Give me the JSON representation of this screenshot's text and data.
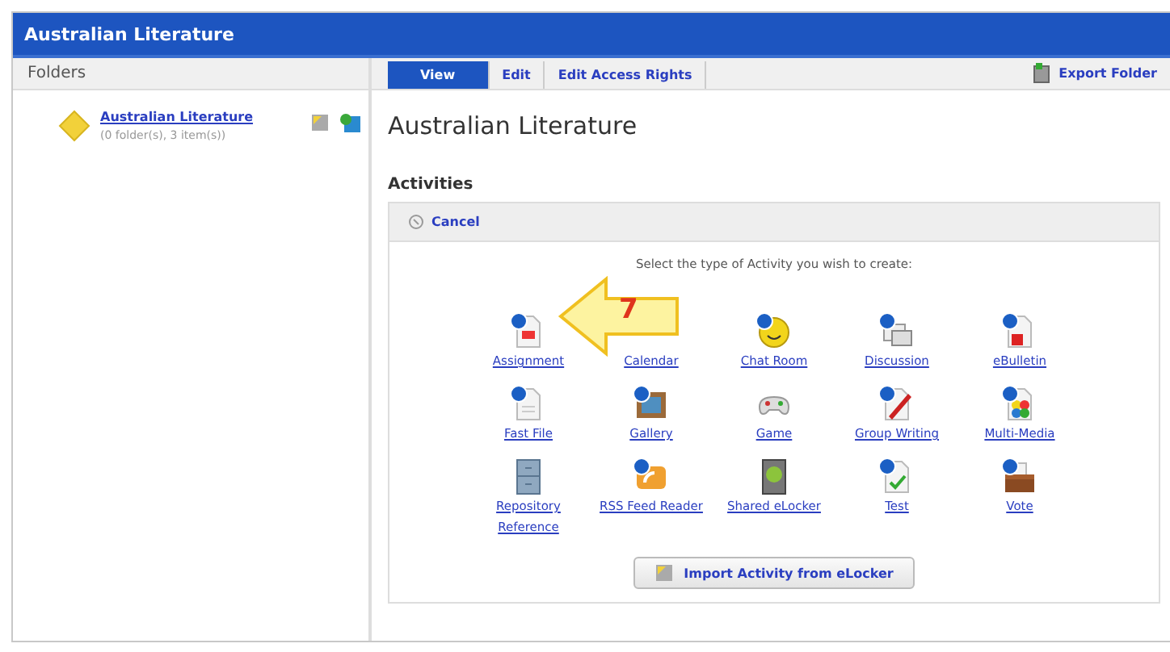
{
  "window": {
    "title": "Australian Literature"
  },
  "sidebar": {
    "header": "Folders",
    "folders": [
      {
        "name": "Australian Literature",
        "meta": "(0 folder(s), 3 item(s))"
      }
    ]
  },
  "tabs": [
    {
      "label": "View",
      "selected": true
    },
    {
      "label": "Edit",
      "selected": false
    },
    {
      "label": "Edit Access Rights",
      "selected": false
    }
  ],
  "export_button": "Export Folder",
  "page_title": "Australian Literature",
  "section_title": "Activities",
  "cancel_link": "Cancel",
  "prompt": "Select the type of Activity you wish to create:",
  "activities": [
    {
      "label": "Assignment",
      "kind": "assignment"
    },
    {
      "label": "Calendar",
      "kind": "calendar"
    },
    {
      "label": "Chat Room",
      "kind": "chat"
    },
    {
      "label": "Discussion",
      "kind": "discussion"
    },
    {
      "label": "eBulletin",
      "kind": "bulletin"
    },
    {
      "label": "Fast File",
      "kind": "file"
    },
    {
      "label": "Gallery",
      "kind": "gallery"
    },
    {
      "label": "Game",
      "kind": "game"
    },
    {
      "label": "Group Writing",
      "kind": "writing"
    },
    {
      "label": "Multi-Media",
      "kind": "media"
    },
    {
      "label": "Repository Reference",
      "kind": "cabinet"
    },
    {
      "label": "RSS Feed Reader",
      "kind": "rss"
    },
    {
      "label": "Shared eLocker",
      "kind": "locker"
    },
    {
      "label": "Test",
      "kind": "test"
    },
    {
      "label": "Vote",
      "kind": "vote"
    }
  ],
  "import_button": "Import Activity from eLocker",
  "callout": {
    "number": "7"
  }
}
